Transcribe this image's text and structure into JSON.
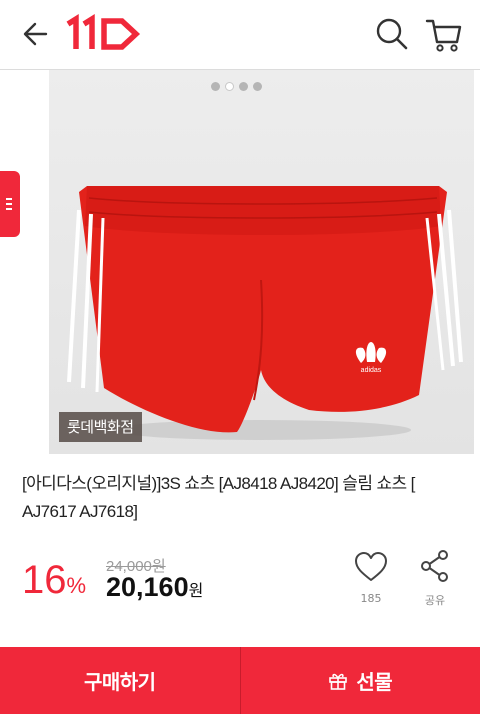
{
  "header": {
    "logo_text": "11",
    "back_icon": "arrow-left-icon",
    "search_icon": "search-icon",
    "cart_icon": "cart-icon"
  },
  "gallery": {
    "total_images": 4,
    "active_index": 1,
    "store_badge": "롯데백화점",
    "brand_logo_text": "adidas"
  },
  "product": {
    "title": "[아디다스(오리지널)]3S 쇼츠 [AJ8418 AJ8420] 슬림 쇼츠 [ AJ7617 AJ7618]",
    "discount_value": "16",
    "discount_unit": "%",
    "original_price": "24,000원",
    "sale_price_value": "20,160",
    "sale_price_unit": "원"
  },
  "actions": {
    "like_count": "185",
    "share_label": "공유"
  },
  "bottom": {
    "buy_label": "구매하기",
    "gift_label": "선물"
  },
  "colors": {
    "accent": "#f0283a",
    "shorts_red": "#e3221b"
  }
}
